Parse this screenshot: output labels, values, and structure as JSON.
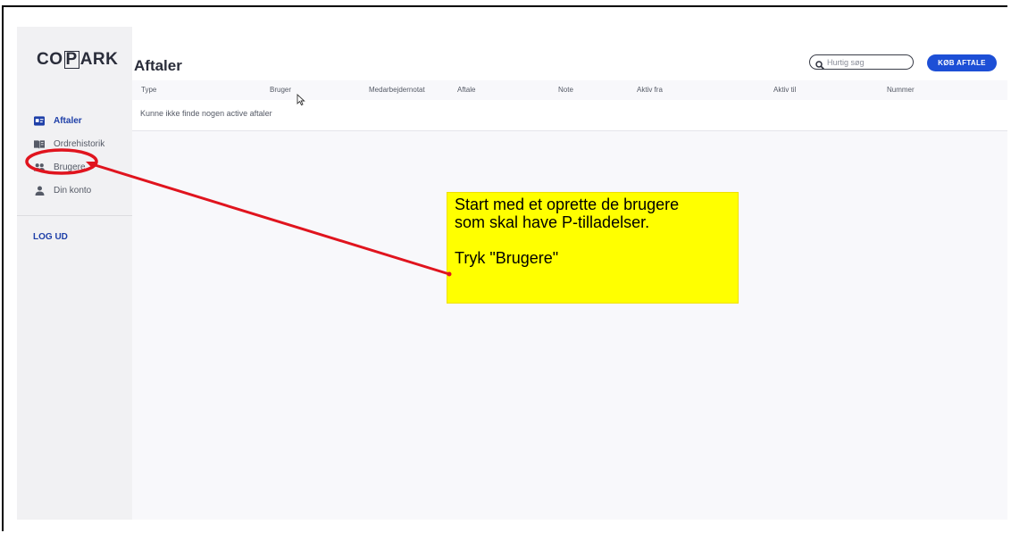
{
  "logo": {
    "part1": "CO",
    "boxed": "P",
    "part2": "ARK"
  },
  "sidebar": {
    "items": [
      {
        "label": "Aftaler",
        "icon": "contract-card-icon",
        "active": true
      },
      {
        "label": "Ordrehistorik",
        "icon": "book-icon",
        "active": false
      },
      {
        "label": "Brugere",
        "icon": "users-icon",
        "active": false
      },
      {
        "label": "Din konto",
        "icon": "user-icon",
        "active": false
      }
    ],
    "logout_label": "LOG UD"
  },
  "header": {
    "title": "Aftaler",
    "search_placeholder": "Hurtig søg",
    "buy_button_label": "KØB AFTALE"
  },
  "table": {
    "columns": [
      "Type",
      "Bruger",
      "Medarbejdernotat",
      "Aftale",
      "Note",
      "Aktiv fra",
      "Aktiv til",
      "Nummer"
    ],
    "empty_message": "Kunne ikke finde nogen active aftaler"
  },
  "annotation": {
    "line1": "Start med et oprette de brugere",
    "line2": "som skal have P-tilladelser.",
    "line3": "Tryk \"Brugere\"",
    "color": "#ffff00",
    "marker_color": "#e0141e"
  },
  "colors": {
    "accent": "#1d4fd6",
    "active_nav": "#1e3fa8"
  }
}
